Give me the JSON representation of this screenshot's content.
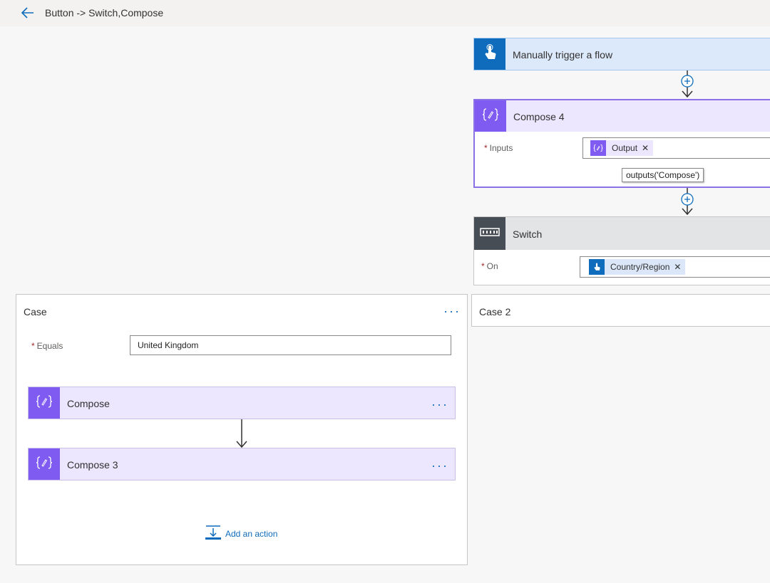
{
  "header": {
    "breadcrumb": "Button -> Switch,Compose",
    "back_icon": "back-arrow-icon"
  },
  "trigger": {
    "title": "Manually trigger a flow",
    "icon": "touch-hand-icon",
    "color": "#0f6cbd",
    "bg": "#dce9fb"
  },
  "compose4": {
    "title": "Compose 4",
    "icon": "compose-braces-icon",
    "inputs_label": "Inputs",
    "token_label": "Output",
    "tooltip": "outputs('Compose')",
    "color": "#7f5bf2",
    "bg": "#ece6fe"
  },
  "switch": {
    "title": "Switch",
    "icon": "switch-icon",
    "on_label": "On",
    "token_label": "Country/Region",
    "color": "#474d55",
    "bg": "#e2e4e6"
  },
  "case1": {
    "title": "Case",
    "equals_label": "Equals",
    "equals_value": "United Kingdom",
    "actions": [
      {
        "title": "Compose"
      },
      {
        "title": "Compose 3"
      }
    ],
    "add_action": "Add an action"
  },
  "case2": {
    "title": "Case 2"
  }
}
